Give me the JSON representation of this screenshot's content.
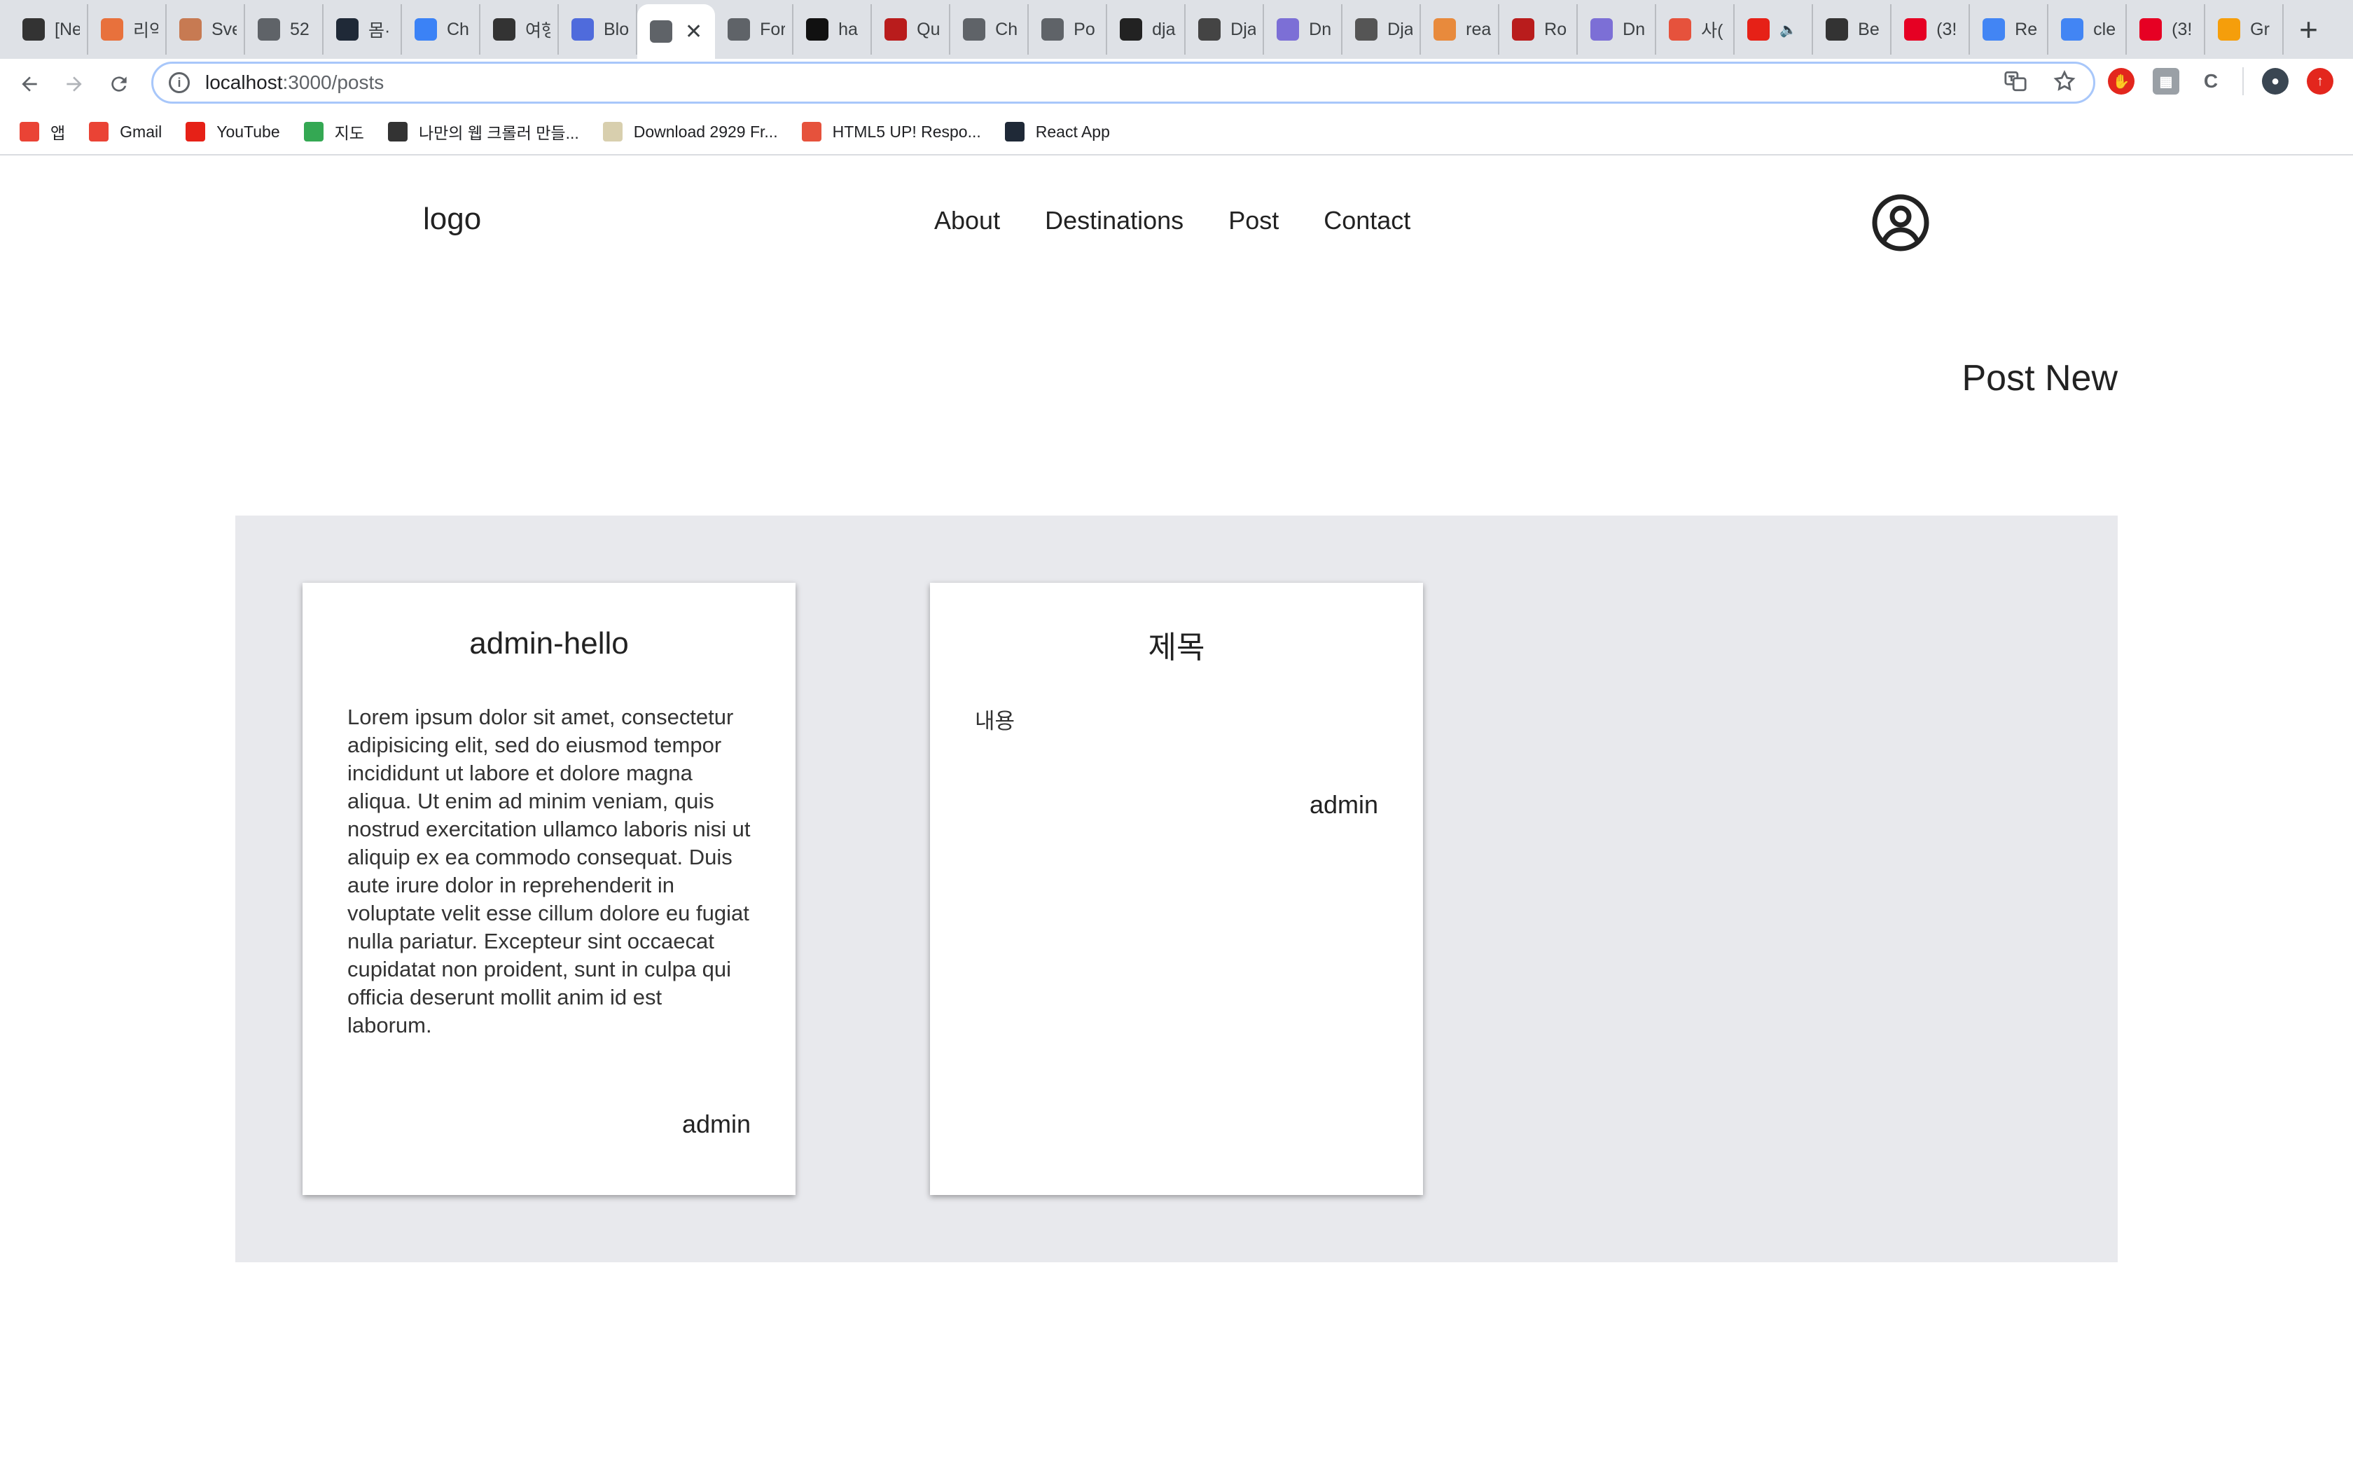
{
  "browser": {
    "tabs": [
      {
        "title": "[Ne",
        "icon": "dark-square-icon",
        "color": "#333333"
      },
      {
        "title": "리악",
        "icon": "orange-app-icon",
        "color": "#e8713c"
      },
      {
        "title": "Sve",
        "icon": "avatar-icon",
        "color": "#c77a52"
      },
      {
        "title": "52",
        "icon": "globe-icon",
        "color": "#5f6368"
      },
      {
        "title": "몸·",
        "icon": "react-icon",
        "color": "#1f2937"
      },
      {
        "title": "Ch",
        "icon": "flag-icon",
        "color": "#3b82f6"
      },
      {
        "title": "여행",
        "icon": "dots-icon",
        "color": "#333333"
      },
      {
        "title": "Blo",
        "icon": "feather-icon",
        "color": "#4f6bdc"
      },
      {
        "title": "",
        "icon": "globe-icon",
        "color": "#5f6368",
        "active": true
      },
      {
        "title": "For",
        "icon": "globe-icon",
        "color": "#5f6368"
      },
      {
        "title": "ha",
        "icon": "github-icon",
        "color": "#111111"
      },
      {
        "title": "Qu",
        "icon": "red-dots-icon",
        "color": "#b91c1c"
      },
      {
        "title": "Ch",
        "icon": "globe-icon",
        "color": "#5f6368"
      },
      {
        "title": "Po",
        "icon": "globe-icon",
        "color": "#5f6368"
      },
      {
        "title": "dja",
        "icon": "half-moon-icon",
        "color": "#222222"
      },
      {
        "title": "Dja",
        "icon": "avatar-icon",
        "color": "#444444"
      },
      {
        "title": "Dn",
        "icon": "v-icon",
        "color": "#7c6fd6"
      },
      {
        "title": "Dja",
        "icon": "symbol-icon",
        "color": "#555555"
      },
      {
        "title": "rea",
        "icon": "stack-icon",
        "color": "#e88a3c"
      },
      {
        "title": "Ro",
        "icon": "red-dots-icon",
        "color": "#b91c1c"
      },
      {
        "title": "Dn",
        "icon": "v-icon",
        "color": "#7c6fd6"
      },
      {
        "title": "사(",
        "icon": "coin-icon",
        "color": "#e6523c"
      },
      {
        "title": "",
        "icon": "youtube-icon",
        "color": "#e62117",
        "audio": true
      },
      {
        "title": "Be",
        "icon": "hash-icon",
        "color": "#333333"
      },
      {
        "title": "(3!",
        "icon": "pinterest-icon",
        "color": "#e60023"
      },
      {
        "title": "Re",
        "icon": "google-icon",
        "color": "#4285f4"
      },
      {
        "title": "cle",
        "icon": "google-icon",
        "color": "#4285f4"
      },
      {
        "title": "(3!",
        "icon": "pinterest-icon",
        "color": "#e60023"
      },
      {
        "title": "Gr",
        "icon": "r-icon",
        "color": "#f59e0b"
      }
    ],
    "url_host": "localhost",
    "url_path": ":3000/posts",
    "bookmarks": [
      {
        "label": "앱",
        "icon": "apps-grid-icon",
        "color": "#ea4335"
      },
      {
        "label": "Gmail",
        "icon": "gmail-icon",
        "color": "#ea4335"
      },
      {
        "label": "YouTube",
        "icon": "youtube-icon",
        "color": "#e62117"
      },
      {
        "label": "지도",
        "icon": "maps-icon",
        "color": "#34a853"
      },
      {
        "label": "나만의 웹 크롤러 만들...",
        "icon": "hash-icon",
        "color": "#333333"
      },
      {
        "label": "Download 2929 Fr...",
        "icon": "image-icon",
        "color": "#d8cfae"
      },
      {
        "label": "HTML5 UP! Respo...",
        "icon": "html5up-icon",
        "color": "#e6523c"
      },
      {
        "label": "React App",
        "icon": "react-icon",
        "color": "#1f2937"
      }
    ]
  },
  "site": {
    "logo": "logo",
    "menu": [
      "About",
      "Destinations",
      "Post",
      "Contact"
    ],
    "post_new": "Post New"
  },
  "posts": [
    {
      "title": "admin-hello",
      "body": "Lorem ipsum dolor sit amet, consectetur adipisicing elit, sed do eiusmod tempor incididunt ut labore et dolore magna aliqua. Ut enim ad minim veniam, quis nostrud exercitation ullamco laboris nisi ut aliquip ex ea commodo consequat. Duis aute irure dolor in reprehenderit in voluptate velit esse cillum dolore eu fugiat nulla pariatur. Excepteur sint occaecat cupidatat non proident, sunt in culpa qui officia deserunt mollit anim id est laborum.",
      "author": "admin"
    },
    {
      "title": "제목",
      "body": "내용",
      "author": "admin"
    }
  ]
}
